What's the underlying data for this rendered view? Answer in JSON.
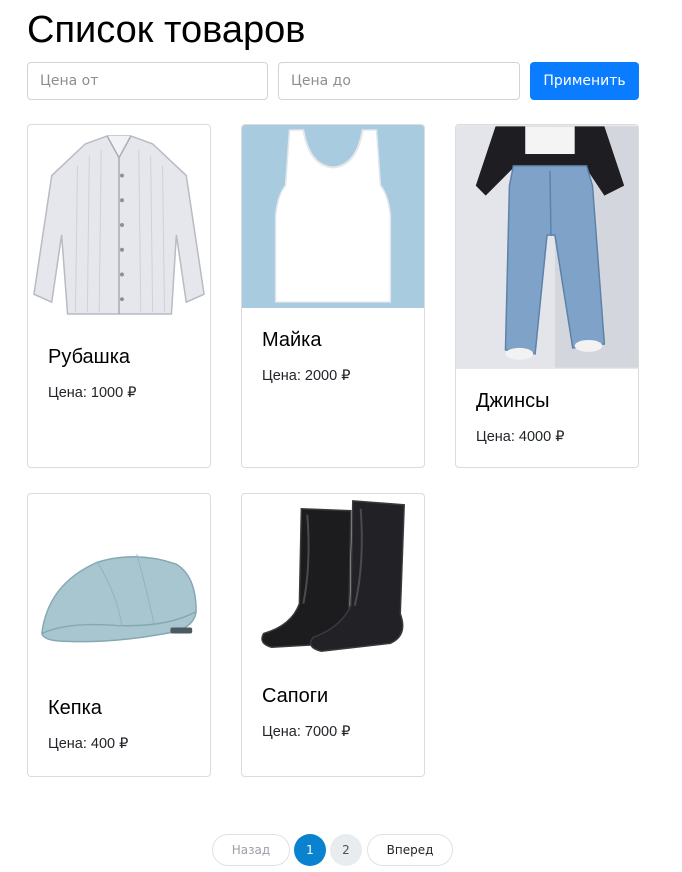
{
  "page": {
    "title": "Список товаров"
  },
  "filters": {
    "price_from_placeholder": "Цена от",
    "price_to_placeholder": "Цена до",
    "apply_label": "Применить"
  },
  "products": [
    {
      "name": "Рубашка",
      "price": "Цена: 1000 ₽",
      "image": "shirt-image"
    },
    {
      "name": "Майка",
      "price": "Цена: 2000 ₽",
      "image": "tank-top-image"
    },
    {
      "name": "Джинсы",
      "price": "Цена: 4000 ₽",
      "image": "jeans-image"
    },
    {
      "name": "Кепка",
      "price": "Цена: 400 ₽",
      "image": "cap-image"
    },
    {
      "name": "Сапоги",
      "price": "Цена: 7000 ₽",
      "image": "boots-image"
    }
  ],
  "pagination": {
    "prev_label": "Назад",
    "pages": [
      "1",
      "2"
    ],
    "current_page": "1",
    "next_label": "Вперед"
  },
  "colors": {
    "accent": "#0a7cff",
    "pager_active": "#0a82d0",
    "tank_top_bg": "#a9cbe0"
  }
}
